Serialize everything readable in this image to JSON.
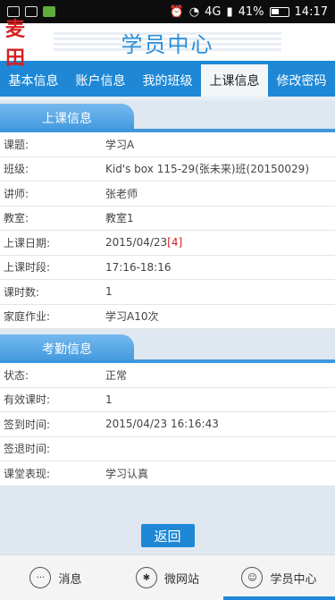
{
  "statusbar": {
    "network": "4G",
    "battery": "41%",
    "time": "14:17"
  },
  "header": {
    "logo_text": "麦田",
    "title": "学员中心"
  },
  "tabs": [
    {
      "label": "基本信息"
    },
    {
      "label": "账户信息"
    },
    {
      "label": "我的班级"
    },
    {
      "label": "上课信息"
    },
    {
      "label": "修改密码"
    }
  ],
  "class_info": {
    "heading": "上课信息",
    "rows": [
      {
        "label": "课题:",
        "value": "学习A"
      },
      {
        "label": "班级:",
        "value": "Kid's box 115-29(张未来)班(20150029)"
      },
      {
        "label": "讲师:",
        "value": "张老师"
      },
      {
        "label": "教室:",
        "value": "教室1"
      },
      {
        "label": "上课日期:",
        "value": "2015/04/23",
        "extra": "[4]"
      },
      {
        "label": "上课时段:",
        "value": "17:16-18:16"
      },
      {
        "label": "课时数:",
        "value": "1"
      },
      {
        "label": "家庭作业:",
        "value": "学习A10次"
      }
    ]
  },
  "attendance": {
    "heading": "考勤信息",
    "rows": [
      {
        "label": "状态:",
        "value": "正常"
      },
      {
        "label": "有效课时:",
        "value": "1"
      },
      {
        "label": "签到时间:",
        "value": "2015/04/23 16:16:43"
      },
      {
        "label": "签退时间:",
        "value": ""
      },
      {
        "label": "课堂表现:",
        "value": "学习认真"
      }
    ]
  },
  "return_label": "返回",
  "bottom_nav": [
    {
      "label": "消息",
      "icon": "chat-icon"
    },
    {
      "label": "微网站",
      "icon": "network-icon"
    },
    {
      "label": "学员中心",
      "icon": "user-icon"
    }
  ],
  "colors": {
    "accent": "#1e88d6",
    "title": "#2a8ed8",
    "highlight": "#d62020"
  }
}
